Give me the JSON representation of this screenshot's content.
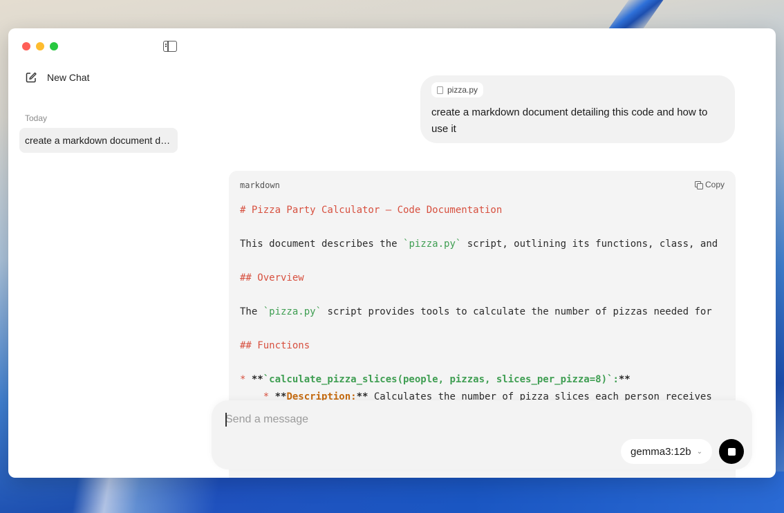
{
  "sidebar": {
    "new_chat_label": "New Chat",
    "section_label": "Today",
    "history": [
      {
        "title": "create a markdown document detailing this code and how to use it"
      }
    ]
  },
  "conversation": {
    "user_message": {
      "attachment_name": "pizza.py",
      "text": "create a markdown document detailing this code and how to use it"
    },
    "code_block": {
      "language": "markdown",
      "copy_label": "Copy",
      "lines": [
        {
          "parts": [
            {
              "t": "# Pizza Party Calculator – Code Documentation",
              "c": "c-heading"
            }
          ]
        },
        {
          "parts": []
        },
        {
          "parts": [
            {
              "t": "This document describes the ",
              "c": ""
            },
            {
              "t": "`pizza.py`",
              "c": "c-code"
            },
            {
              "t": " script, outlining its functions, class, and",
              "c": ""
            }
          ]
        },
        {
          "parts": []
        },
        {
          "parts": [
            {
              "t": "## Overview",
              "c": "c-heading"
            }
          ]
        },
        {
          "parts": []
        },
        {
          "parts": [
            {
              "t": "The ",
              "c": ""
            },
            {
              "t": "`pizza.py`",
              "c": "c-code"
            },
            {
              "t": " script provides tools to calculate the number of pizzas needed for",
              "c": ""
            }
          ]
        },
        {
          "parts": []
        },
        {
          "parts": [
            {
              "t": "## Functions",
              "c": "c-heading"
            }
          ]
        },
        {
          "parts": []
        },
        {
          "parts": [
            {
              "t": "* ",
              "c": "c-bullet"
            },
            {
              "t": "**",
              "c": "c-stars"
            },
            {
              "t": "`calculate_pizza_slices(people, pizzas, slices_per_pizza=8)`:",
              "c": "c-bold-code"
            },
            {
              "t": "**",
              "c": "c-stars"
            }
          ]
        },
        {
          "parts": [
            {
              "t": "    * ",
              "c": "c-bullet"
            },
            {
              "t": "**",
              "c": "c-stars"
            },
            {
              "t": "Description:",
              "c": "c-bold-label"
            },
            {
              "t": "**",
              "c": "c-stars"
            },
            {
              "t": " Calculates the number of pizza slices each person receives",
              "c": ""
            }
          ]
        }
      ]
    }
  },
  "composer": {
    "placeholder": "Send a message",
    "model": "gemma3:12b"
  }
}
